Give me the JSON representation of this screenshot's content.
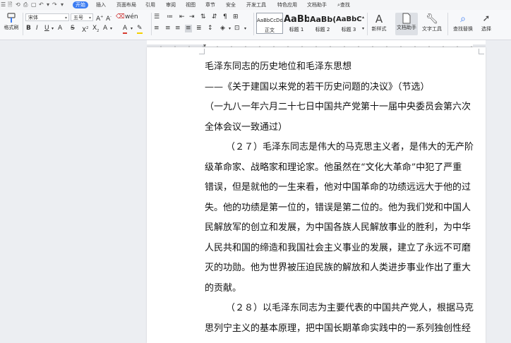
{
  "menu": {
    "tabs": [
      "开始",
      "插入",
      "页面布局",
      "引用",
      "审阅",
      "视图",
      "章节",
      "安全",
      "开发工具",
      "特色应用",
      "文档助手"
    ],
    "search_label": "查找"
  },
  "ribbon": {
    "format_painter": "格式刷",
    "font_name": "宋体",
    "font_size": "五号",
    "styles": [
      {
        "preview": "AaBbCcDd",
        "label": "正文"
      },
      {
        "preview": "AaBb",
        "label": "标题 1"
      },
      {
        "preview": "AaBb(",
        "label": "标题 2"
      },
      {
        "preview": "AaBbC",
        "label": "标题 3"
      }
    ],
    "new_style": "新样式",
    "doc_assistant": "文档助手",
    "text_tools": "文字工具",
    "find_replace": "查找替换",
    "select": "选择"
  },
  "document": {
    "lines": [
      "毛泽东同志的历史地位和毛泽东思想",
      "——《关于建国以来党的若干历史问题的决议》（节选）",
      "（一九八一年六月二十七日中国共产党第十一届中央委员会第六次",
      "全体会议一致通过）",
      "（２７）毛泽东同志是伟大的马克思主义者，是伟大的无产阶",
      "级革命家、战略家和理论家。他虽然在“文化大革命”中犯了严重",
      "错误，但是就他的一生来看，他对中国革命的功绩远远大于他的过",
      "失。他的功绩是第一位的，错误是第二位的。他为我们党和中国人",
      "民解放军的创立和发展，为中国各族人民解放事业的胜利，为中华",
      "人民共和国的缔造和我国社会主义事业的发展，建立了永远不可磨",
      "灭的功勋。他为世界被压迫民族的解放和人类进步事业作出了重大",
      "的贡献。",
      "（２８）以毛泽东同志为主要代表的中国共产党人，根据马克",
      "思列宁主义的基本原理，把中国长期革命实践中的一系列独创性经"
    ]
  },
  "colors": {
    "accent": "#3b7cf2",
    "font_color": "#d83a2e",
    "highlight": "#f5d000",
    "shading": "#3b7cf2"
  }
}
